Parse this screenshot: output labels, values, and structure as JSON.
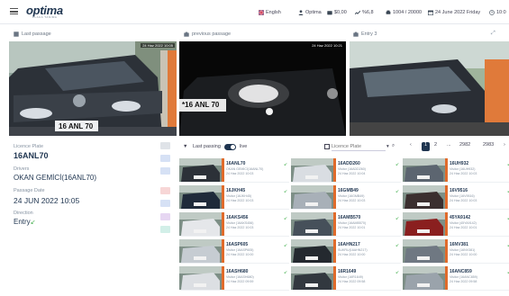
{
  "topbar": {
    "brand": "optima",
    "brand_sub": "PLAKA TANIMA",
    "language": "Englsh",
    "user": "Optima",
    "money": "$0,00",
    "stat": "%6,8",
    "count": "1004 / 20000",
    "date": "24 June 2022 Friday",
    "time": "10:0"
  },
  "panels": {
    "last_passage": "Last passage",
    "previous_passage": "previous passage",
    "entry": "Entry 3",
    "stamp_last": "24 Haz 2022 10:05",
    "stamp_prev": "24 Haz 2022 10:21"
  },
  "plates": {
    "main": "16 ANL 70",
    "prev": "*16 ANL 70"
  },
  "details": {
    "licence_plate_label": "Licence Plate",
    "licence_plate": "16ANL70",
    "drivers_label": "Drivers",
    "driver": "OKAN GEMİCİ(16ANL70)",
    "passage_date_label": "Passage Date",
    "passage_date": "24 JUN 2022 10:05",
    "direction_label": "Direction",
    "direction": "Entry"
  },
  "filter": {
    "last_passing": "Last passing",
    "live": "live",
    "plate_placeholder": "Licence Plate"
  },
  "pager": {
    "p1": "1",
    "p2": "2",
    "dots": "...",
    "p3": "2982",
    "p4": "2983"
  },
  "cards": [
    {
      "plate": "16ANL70",
      "driver": "OKAN GEMİCİ(16ANL70)",
      "date": "24 Haz 2022 10:03"
    },
    {
      "plate": "16ADD260",
      "driver": "Visitor (16ADD260)",
      "date": "24 Haz 2022 10:04"
    },
    {
      "plate": "16UH932",
      "driver": "Visitor (16UH932)",
      "date": "24 Haz 2022 10:03"
    },
    {
      "plate": "16JKH45",
      "driver": "Visitor (16JKH45)",
      "date": "24 Haz 2022 10:03"
    },
    {
      "plate": "16GMB49",
      "driver": "Visitor (16GMB49)",
      "date": "24 Haz 2022 10:03"
    },
    {
      "plate": "16V9516",
      "driver": "Visitor (16V9516)",
      "date": "24 Haz 2022 10:03"
    },
    {
      "plate": "16AKS456",
      "driver": "Visitor (16AKS456)",
      "date": "24 Haz 2022 10:03"
    },
    {
      "plate": "16AMB570",
      "driver": "Visitor (16AMB570)",
      "date": "24 Haz 2022 10:01"
    },
    {
      "plate": "45YA9142",
      "driver": "Visitor (45YA9142)",
      "date": "24 Haz 2022 10:01"
    },
    {
      "plate": "16ASP605",
      "driver": "Visitor (16ASP605)",
      "date": "24 Haz 2022 10:00"
    },
    {
      "plate": "16AHN217",
      "driver": "SUKRU(16AHN217)",
      "date": "24 Haz 2022 10:00"
    },
    {
      "plate": "16NV381",
      "driver": "Visitor (16NV381)",
      "date": "24 Haz 2022 10:00"
    },
    {
      "plate": "16ASH680",
      "driver": "Visitor (16ASH680)",
      "date": "24 Haz 2022 09:59"
    },
    {
      "plate": "16R1649",
      "driver": "Visitor (16R1649)",
      "date": "24 Haz 2022 09:58"
    },
    {
      "plate": "16ANC859",
      "driver": "Visitor (16ANC859)",
      "date": "24 Haz 2022 09:58"
    }
  ],
  "colors": {
    "accent": "#1f3550",
    "entry_arrow": "#3fae49",
    "bar": "#e06b2b"
  }
}
